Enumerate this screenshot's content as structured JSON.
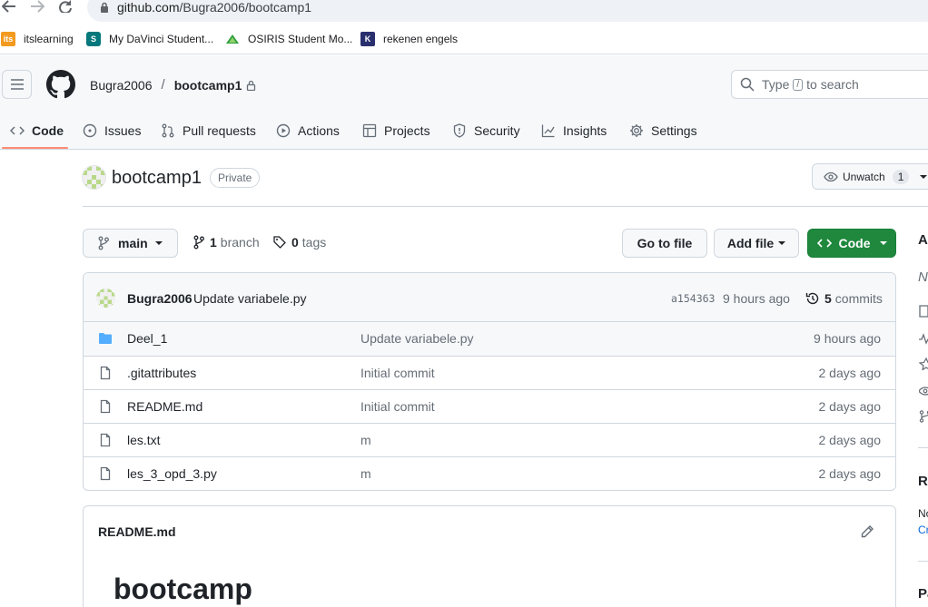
{
  "browser": {
    "url_host": "github.com",
    "url_path": "/Bugra2006/bootcamp1",
    "bookmarks": [
      {
        "label": "itslearning",
        "icon": "its"
      },
      {
        "label": "My DaVinci Student...",
        "icon": "S"
      },
      {
        "label": "OSIRIS Student Mo...",
        "icon": "osiris-icon"
      },
      {
        "label": "rekenen engels",
        "icon": "K"
      }
    ]
  },
  "header": {
    "owner": "Bugra2006",
    "separator": "/",
    "repo": "bootcamp1",
    "search_prefix": "Type",
    "search_key": "/",
    "search_suffix": "to search"
  },
  "tabs": [
    {
      "label": "Code",
      "icon": "code-icon"
    },
    {
      "label": "Issues",
      "icon": "issue-icon"
    },
    {
      "label": "Pull requests",
      "icon": "pull-request-icon"
    },
    {
      "label": "Actions",
      "icon": "play-icon"
    },
    {
      "label": "Projects",
      "icon": "table-icon"
    },
    {
      "label": "Security",
      "icon": "shield-icon"
    },
    {
      "label": "Insights",
      "icon": "graph-icon"
    },
    {
      "label": "Settings",
      "icon": "gear-icon"
    }
  ],
  "repo": {
    "name": "bootcamp1",
    "visibility": "Private",
    "watch_label": "Unwatch",
    "watch_count": "1"
  },
  "branch_bar": {
    "branch": "main",
    "branch_count": "1",
    "branch_label": "branch",
    "tag_count": "0",
    "tag_label": "tags",
    "goto_file": "Go to file",
    "add_file": "Add file",
    "code": "Code"
  },
  "latest_commit": {
    "author": "Bugra2006",
    "message": "Update variabele.py",
    "sha": "a154363",
    "time": "9 hours ago",
    "commit_count": "5",
    "commit_label": "commits"
  },
  "files": [
    {
      "name": "Deel_1",
      "type": "folder",
      "message": "Update variabele.py",
      "time": "9 hours ago"
    },
    {
      "name": ".gitattributes",
      "type": "file",
      "message": "Initial commit",
      "time": "2 days ago"
    },
    {
      "name": "README.md",
      "type": "file",
      "message": "Initial commit",
      "time": "2 days ago"
    },
    {
      "name": "les.txt",
      "type": "file",
      "message": "m",
      "time": "2 days ago"
    },
    {
      "name": "les_3_opd_3.py",
      "type": "file",
      "message": "m",
      "time": "2 days ago"
    }
  ],
  "readme": {
    "title": "README.md",
    "heading": "bootcamp"
  },
  "sidebar_fragments": {
    "about": "A",
    "about_desc": "N",
    "releases": "R",
    "releases_desc": "No",
    "releases_link": "Cr",
    "packages": "Pa"
  },
  "colors": {
    "primary_button": "#1f883d",
    "active_tab_underline": "#fd8c73",
    "folder_icon": "#54aeff",
    "text_muted": "#656d76"
  }
}
